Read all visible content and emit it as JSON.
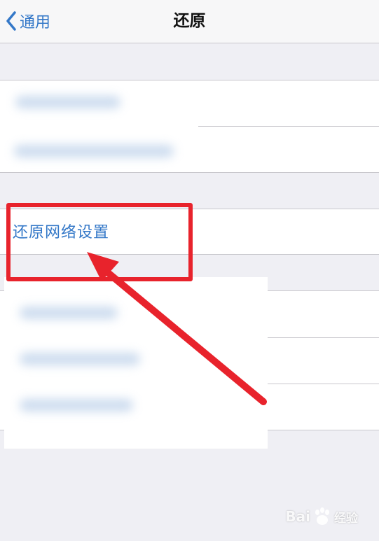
{
  "navbar": {
    "back_label": "通用",
    "title": "还原"
  },
  "reset_network": {
    "label": "还原网络设置"
  },
  "annotation": {
    "color": "#e8232c"
  },
  "watermark": {
    "brand": "Bai",
    "suffix": "经验"
  },
  "colors": {
    "accent": "#3478c8",
    "background": "#efeff4"
  }
}
